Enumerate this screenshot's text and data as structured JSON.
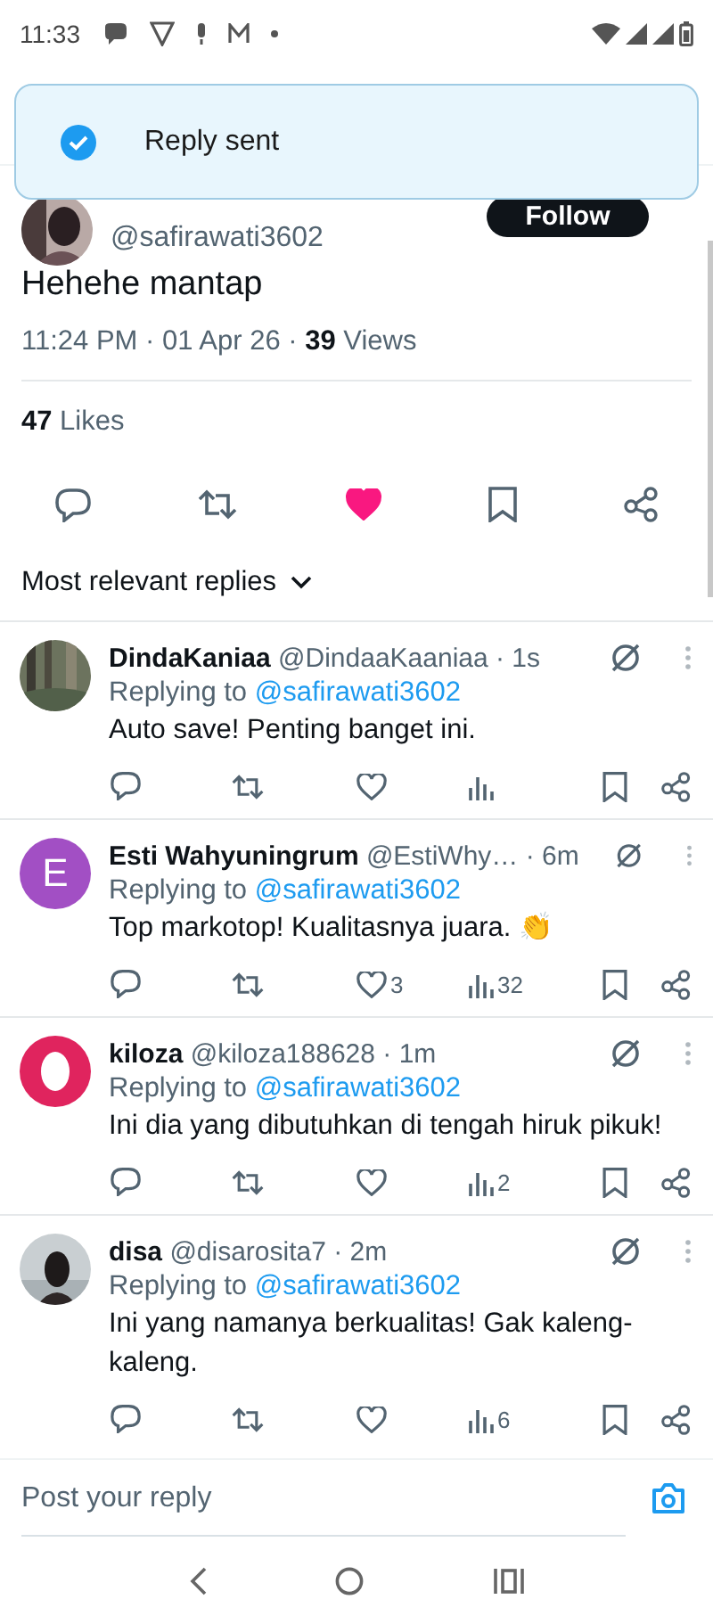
{
  "status_bar": {
    "time": "11:33"
  },
  "toast": {
    "message": "Reply sent"
  },
  "post": {
    "author_handle": "@safirawati3602",
    "follow_label": "Follow",
    "text": "Hehehe mantap",
    "timestamp": "11:24 PM · 01 Apr 26 · ",
    "views_count": "39",
    "views_label": " Views",
    "likes_count": "47",
    "likes_label": " Likes",
    "liked": true
  },
  "replies_sort": {
    "label": "Most relevant replies"
  },
  "replies": [
    {
      "name": "DindaKaniaa",
      "handle": "@DindaaKaaniaa",
      "time": " · 1s",
      "replying_prefix": "Replying to ",
      "replying_handle": "@safirawati3602",
      "text": "Auto save! Penting banget ini.",
      "liked": false
    },
    {
      "avatar": {
        "kind": "letter",
        "letter": "E",
        "color": "#a24fc4"
      },
      "name": "Esti Wahyuningrum",
      "handle": "@EstiWhy…",
      "time": " · 6m",
      "replying_prefix": "Replying to ",
      "replying_handle": "@safirawati3602",
      "text": "Top markotop! Kualitasnya juara. 👏",
      "likes": "3",
      "views": "32",
      "liked": false
    },
    {
      "avatar": {
        "kind": "ring",
        "color": "#e0245e"
      },
      "name": "kiloza",
      "handle": "@kiloza188628",
      "time": " · 1m",
      "replying_prefix": "Replying to ",
      "replying_handle": "@safirawati3602",
      "text": "Ini dia yang dibutuhkan di tengah hiruk pikuk!",
      "views": "2",
      "liked": false
    },
    {
      "name": "disa",
      "handle": "@disarosita7",
      "time": " · 2m",
      "replying_prefix": "Replying to ",
      "replying_handle": "@safirawati3602",
      "text": "Ini yang namanya berkualitas! Gak kaleng-kaleng.",
      "views": "6",
      "liked": false
    }
  ],
  "reply_box": {
    "placeholder": "Post your reply"
  }
}
